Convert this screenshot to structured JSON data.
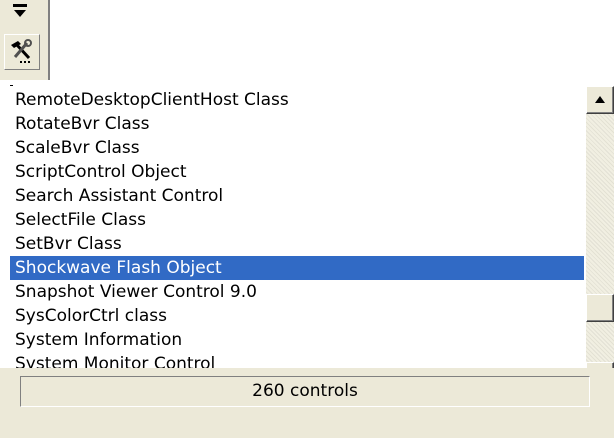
{
  "toolbar": {
    "dropdown_icon": "dropdown-arrow-icon",
    "more_controls_icon": "hammer-tools-icon"
  },
  "list": {
    "items": [
      {
        "label": "RemoteDesktopClientHost Class",
        "selected": false
      },
      {
        "label": "RotateBvr Class",
        "selected": false
      },
      {
        "label": "ScaleBvr Class",
        "selected": false
      },
      {
        "label": "ScriptControl Object",
        "selected": false
      },
      {
        "label": "Search Assistant Control",
        "selected": false
      },
      {
        "label": "SelectFile Class",
        "selected": false
      },
      {
        "label": "SetBvr Class",
        "selected": false
      },
      {
        "label": "Shockwave Flash Object",
        "selected": true
      },
      {
        "label": "Snapshot Viewer Control 9.0",
        "selected": false
      },
      {
        "label": "SysColorCtrl class",
        "selected": false
      },
      {
        "label": "System Information",
        "selected": false
      },
      {
        "label": "System Monitor Control",
        "selected": false
      }
    ],
    "selection_color": "#316AC5"
  },
  "scrollbar": {
    "up_icon": "scroll-up-arrow-icon",
    "down_icon": "scroll-down-arrow-icon",
    "position_fraction": 0.82
  },
  "status": {
    "text": "260 controls"
  }
}
